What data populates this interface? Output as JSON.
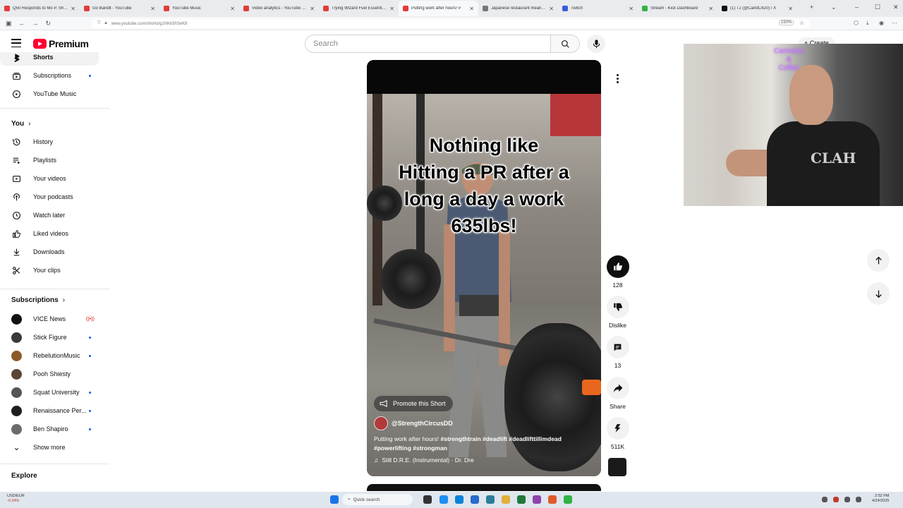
{
  "browser": {
    "tabs": [
      {
        "title": "Q50 Responds to Mo P. Shooting",
        "color": "#e23b3b"
      },
      {
        "title": "Go Bandit - YouTube",
        "color": "#e23b3b"
      },
      {
        "title": "YouTube Music",
        "color": "#e23b3b"
      },
      {
        "title": "Video analytics - YouTube Studio",
        "color": "#e23b3b"
      },
      {
        "title": "Trying Wizard Fuel Essential in",
        "color": "#e23b3b"
      },
      {
        "title": "Putting work after hours! #",
        "color": "#e23b3b",
        "active": true
      },
      {
        "title": "Japanese restaurant meaning",
        "color": "#777777"
      },
      {
        "title": "Twitch",
        "color": "#3b5bdb"
      },
      {
        "title": "Stream - Kick Dashboard",
        "color": "#2fb344"
      },
      {
        "title": "(1) TJ (@CandC420) / X",
        "color": "#111111"
      }
    ],
    "url": "www.youtube.com/shorts/g1NKk5hSeK8",
    "zoom": "150%"
  },
  "header": {
    "brand": "Premium",
    "search_placeholder": "Search",
    "create_label": "Create"
  },
  "sidebar": {
    "top_items": [
      {
        "label": "Shorts",
        "icon": "shorts-icon"
      },
      {
        "label": "Subscriptions",
        "icon": "subscriptions-icon",
        "dot": true
      },
      {
        "label": "YouTube Music",
        "icon": "youtube-music-icon"
      }
    ],
    "you_heading": "You",
    "you_items": [
      {
        "label": "History",
        "icon": "history-icon"
      },
      {
        "label": "Playlists",
        "icon": "playlists-icon"
      },
      {
        "label": "Your videos",
        "icon": "your-videos-icon"
      },
      {
        "label": "Your podcasts",
        "icon": "podcasts-icon"
      },
      {
        "label": "Watch later",
        "icon": "watch-later-icon"
      },
      {
        "label": "Liked videos",
        "icon": "liked-icon"
      },
      {
        "label": "Downloads",
        "icon": "download-icon"
      },
      {
        "label": "Your clips",
        "icon": "clips-icon"
      }
    ],
    "subscriptions_heading": "Subscriptions",
    "subscriptions": [
      {
        "label": "VICE News",
        "avatar_color": "#111111",
        "live": true
      },
      {
        "label": "Stick Figure",
        "avatar_color": "#3a3a3a",
        "dot": true
      },
      {
        "label": "RebelutionMusic",
        "avatar_color": "#8a5a2b",
        "dot": true
      },
      {
        "label": "Pooh Shiesty",
        "avatar_color": "#5a4636"
      },
      {
        "label": "Squat University",
        "avatar_color": "#555555",
        "dot": true
      },
      {
        "label": "Renaissance Per...",
        "avatar_color": "#1e1e1e",
        "dot": true
      },
      {
        "label": "Ben Shapiro",
        "avatar_color": "#6b6b6b",
        "dot": true
      }
    ],
    "show_more": "Show more",
    "explore_heading": "Explore"
  },
  "short": {
    "caption_lines": [
      "Nothing like",
      "Hitting a PR after a",
      "long a day a work",
      "635lbs!"
    ],
    "promote_label": "Promote this Short",
    "channel": "@StrengthCircusDD",
    "description_text": "Putting work after hours!",
    "description_tags": "#strengthtrain #deadlift #deadlifttillimdead #powerlifting #strongman",
    "music": "Still D.R.E. (Instrumental) · Dr. Dre"
  },
  "actions": {
    "likes": "128",
    "dislike_label": "Dislike",
    "comments": "13",
    "share_label": "Share",
    "remix_count": "511K"
  },
  "webcam": {
    "neon_lines": [
      "Cannabis",
      "&",
      "Coffee"
    ],
    "shirt_text": "CLAH"
  },
  "taskbar": {
    "weather_line1": "USD/EUR",
    "weather_line2": "-0.34%",
    "search_placeholder": "Quick search",
    "time": "2:52 PM",
    "date": "4/24/2025"
  }
}
